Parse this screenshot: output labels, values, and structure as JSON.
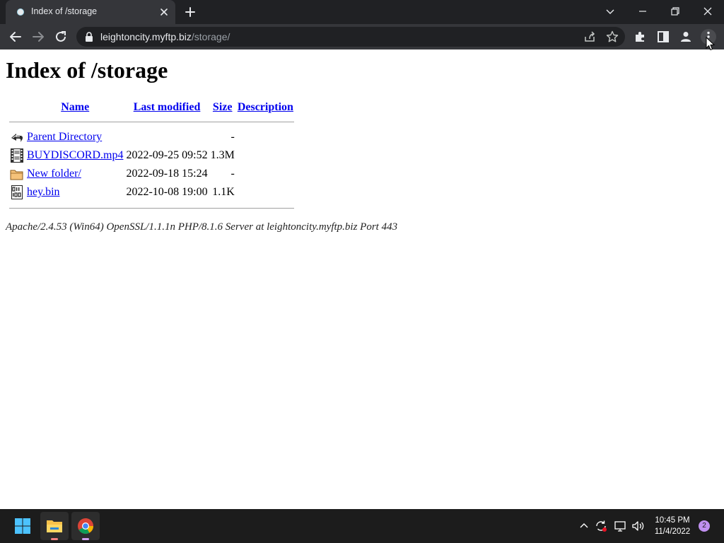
{
  "browser": {
    "tab": {
      "title": "Index of /storage"
    },
    "address": {
      "host": "leightoncity.myftp.biz",
      "path": "/storage/"
    }
  },
  "page": {
    "title": "Index of /storage",
    "columns": {
      "name": "Name",
      "last_modified": "Last modified",
      "size": "Size",
      "description": "Description"
    },
    "entries": [
      {
        "icon": "back-arrow-icon",
        "name": "Parent Directory",
        "modified": "",
        "size": "-"
      },
      {
        "icon": "video-file-icon",
        "name": "BUYDISCORD.mp4",
        "modified": "2022-09-25 09:52",
        "size": "1.3M"
      },
      {
        "icon": "folder-icon",
        "name": "New folder/",
        "modified": "2022-09-18 15:24",
        "size": "-"
      },
      {
        "icon": "binary-file-icon",
        "name": "hey.bin",
        "modified": "2022-10-08 19:00",
        "size": "1.1K"
      }
    ],
    "server_signature": "Apache/2.4.53 (Win64) OpenSSL/1.1.1n PHP/8.1.6 Server at leightoncity.myftp.biz Port 443"
  },
  "taskbar": {
    "time": "10:45 PM",
    "date": "11/4/2022",
    "notification_count": "2"
  },
  "colors": {
    "link": "#0000ee",
    "chrome_dark": "#202124",
    "chrome_toolbar": "#35363a",
    "taskbar": "#1c1c1c"
  }
}
